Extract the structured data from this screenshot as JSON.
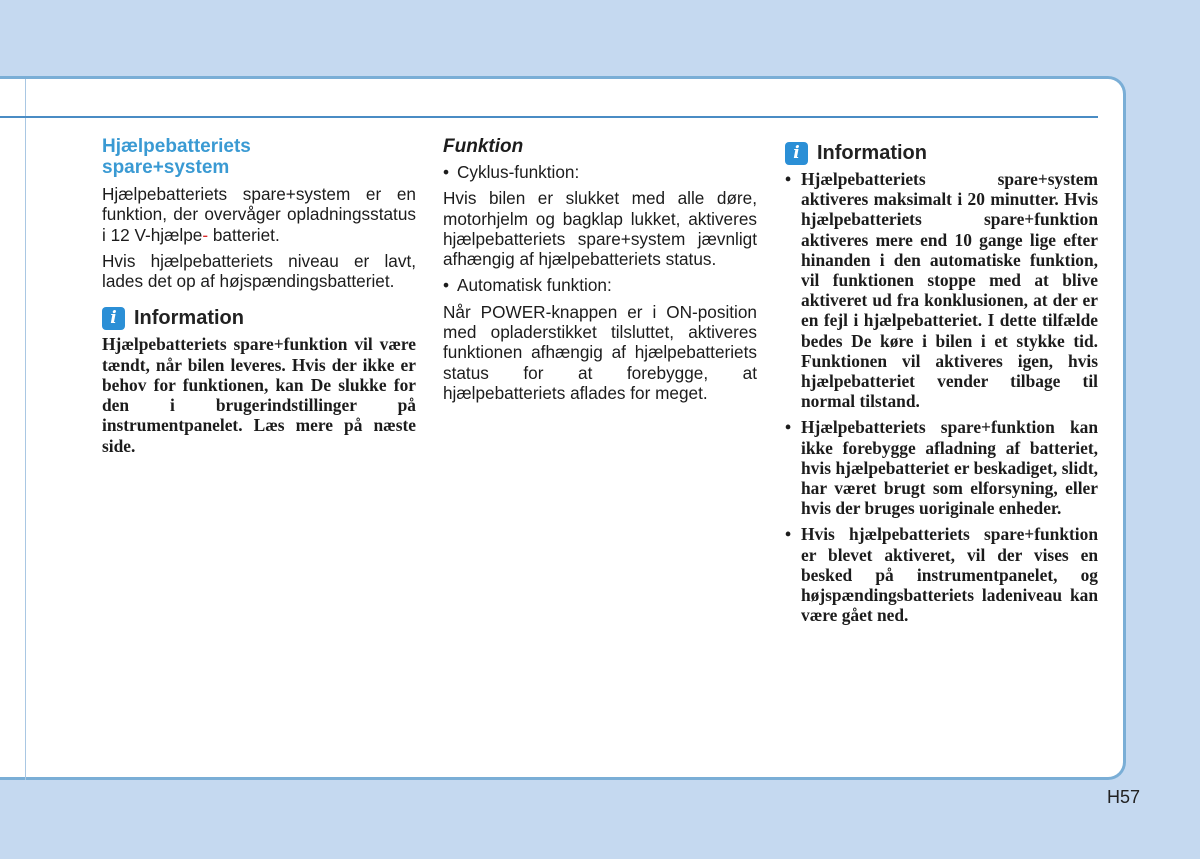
{
  "page_number": "H57",
  "col1": {
    "title_line1": "Hjælpebatteriets",
    "title_line2": "spare+system",
    "para1_a": "Hjælpebatteriets spare+system er en funktion, der overvåger opladningsstatus i 12 V-hjælpe",
    "para1_hyphen": "-",
    "para1_b": "batteriet.",
    "para2": "Hvis hjælpebatteriets niveau er lavt, lades det op af højspændingsbatteriet.",
    "info": {
      "icon": "i",
      "title": "Information",
      "text": "Hjælpebatteriets spare+funktion vil være tændt, når bilen leveres. Hvis der ikke er behov for funktionen, kan De slukke for den i brugerindstillinger på instrumentpanelet. Læs mere på næste side."
    }
  },
  "col2": {
    "title": "Funktion",
    "bullet1": "Cyklus-funktion:",
    "para1": "Hvis bilen er slukket med alle døre, motorhjelm og bagklap lukket, aktiveres hjælpebatteriets spare+system jævnligt afhængig af hjælpebatteriets status.",
    "bullet2": "Automatisk funktion:",
    "para2": "Når POWER-knappen er i ON-position med opladerstikket tilsluttet, aktiveres funktionen afhængig af hjælpebatteriets status for at forebygge, at hjælpebatteriets aflades for meget."
  },
  "col3": {
    "info": {
      "icon": "i",
      "title": "Information",
      "items": [
        "Hjælpebatteriets spare+system aktiveres maksimalt i 20 minutter. Hvis hjælpebatteriets spare+funktion aktiveres mere end 10 gange lige efter hinanden i den automatiske funktion, vil funktionen stoppe med at blive aktiveret ud fra konklusionen, at der er en fejl i hjælpebatteriet. I dette tilfælde bedes De køre i bilen i et stykke tid. Funktionen vil aktiveres igen, hvis hjælpebatteriet vender tilbage til normal tilstand.",
        "Hjælpebatteriets spare+funktion kan ikke forebygge afladning af batteriet, hvis hjælpebatteriet er beskadiget, slidt, har været brugt som elforsyning, eller hvis der bruges uoriginale enheder.",
        "Hvis hjælpebatteriets spare+funktion er blevet aktiveret, vil der vises en besked på instrumentpanelet, og højspændingsbatteriets ladeniveau kan være gået ned."
      ]
    }
  }
}
